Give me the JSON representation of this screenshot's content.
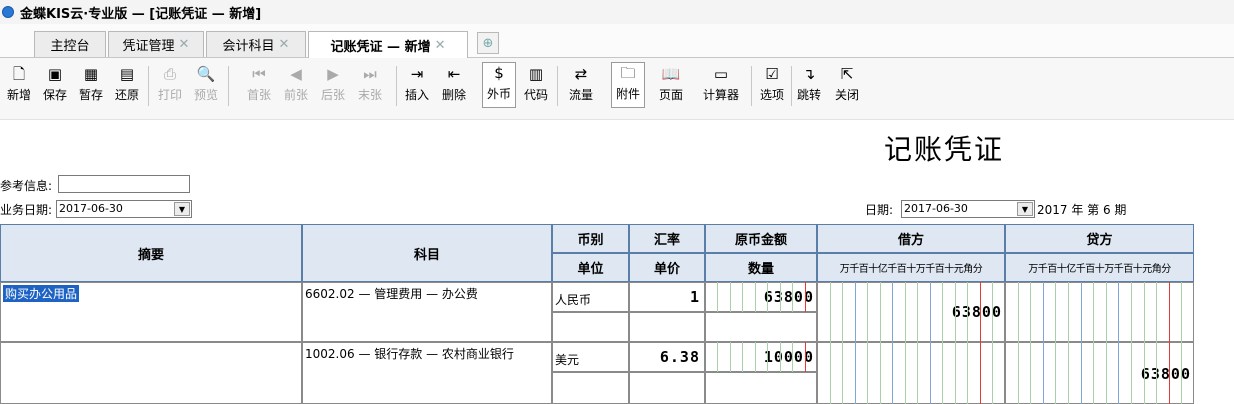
{
  "window": {
    "title": "金蝶KIS云·专业版 — [记账凭证 — 新增]"
  },
  "tabs": [
    {
      "label": "主控台",
      "closable": false,
      "active": false
    },
    {
      "label": "凭证管理",
      "closable": true,
      "active": false
    },
    {
      "label": "会计科目",
      "closable": true,
      "active": false
    },
    {
      "label": "记账凭证 — 新增",
      "closable": true,
      "active": true
    }
  ],
  "toolbar": {
    "buttons": [
      {
        "label": "新增",
        "icon": "new-doc-icon",
        "disabled": false
      },
      {
        "label": "保存",
        "icon": "save-icon",
        "disabled": false
      },
      {
        "label": "暂存",
        "icon": "temp-save-icon",
        "disabled": false
      },
      {
        "label": "还原",
        "icon": "restore-icon",
        "disabled": false
      },
      {
        "label": "打印",
        "icon": "print-icon",
        "disabled": true
      },
      {
        "label": "预览",
        "icon": "preview-icon",
        "disabled": true
      },
      {
        "label": "首张",
        "icon": "first-icon",
        "disabled": true
      },
      {
        "label": "前张",
        "icon": "prev-icon",
        "disabled": true
      },
      {
        "label": "后张",
        "icon": "next-icon",
        "disabled": true
      },
      {
        "label": "末张",
        "icon": "last-icon",
        "disabled": true
      },
      {
        "label": "插入",
        "icon": "insert-row-icon",
        "disabled": false
      },
      {
        "label": "删除",
        "icon": "delete-row-icon",
        "disabled": false
      },
      {
        "label": "外币",
        "icon": "currency-icon",
        "disabled": false,
        "pressed": true
      },
      {
        "label": "代码",
        "icon": "code-icon",
        "disabled": false
      },
      {
        "label": "流量",
        "icon": "cashflow-icon",
        "disabled": false
      },
      {
        "label": "附件",
        "icon": "attachment-icon",
        "disabled": false
      },
      {
        "label": "页面",
        "icon": "page-icon",
        "disabled": false
      },
      {
        "label": "计算器",
        "icon": "calculator-icon",
        "disabled": false
      },
      {
        "label": "选项",
        "icon": "options-icon",
        "disabled": false
      },
      {
        "label": "跳转",
        "icon": "jump-icon",
        "disabled": false
      },
      {
        "label": "关闭",
        "icon": "close-icon",
        "disabled": false
      }
    ]
  },
  "voucher": {
    "title": "记账凭证",
    "ref_label": "参考信息:",
    "ref_value": "",
    "biz_date_label": "业务日期:",
    "biz_date": "2017-06-30",
    "date_label": "日期:",
    "date": "2017-06-30",
    "period_text": "2017 年 第 6 期"
  },
  "grid": {
    "headers": {
      "summary": "摘要",
      "account": "科目",
      "currency": "币别",
      "unit": "单位",
      "rate": "汇率",
      "price": "单价",
      "orig_amount": "原币金额",
      "quantity": "数量",
      "debit": "借方",
      "credit": "贷方",
      "digits": "万千百十亿千百十万千百十元角分"
    },
    "rows": [
      {
        "summary": "购买办公用品",
        "account": "6602.02 — 管理费用 — 办公费",
        "currency": "人民币",
        "rate": "1",
        "orig": "63800",
        "debit": "63800",
        "credit": ""
      },
      {
        "summary": "",
        "account": "1002.06 — 银行存款 — 农村商业银行",
        "currency": "美元",
        "rate": "6.38",
        "orig": "10000",
        "debit": "",
        "credit": "63800"
      }
    ]
  },
  "colors": {
    "header_bg": "#dfe7f2",
    "selection": "#1e63c4",
    "grid_line": "#aad0aa",
    "red_line": "#e23a3a"
  }
}
